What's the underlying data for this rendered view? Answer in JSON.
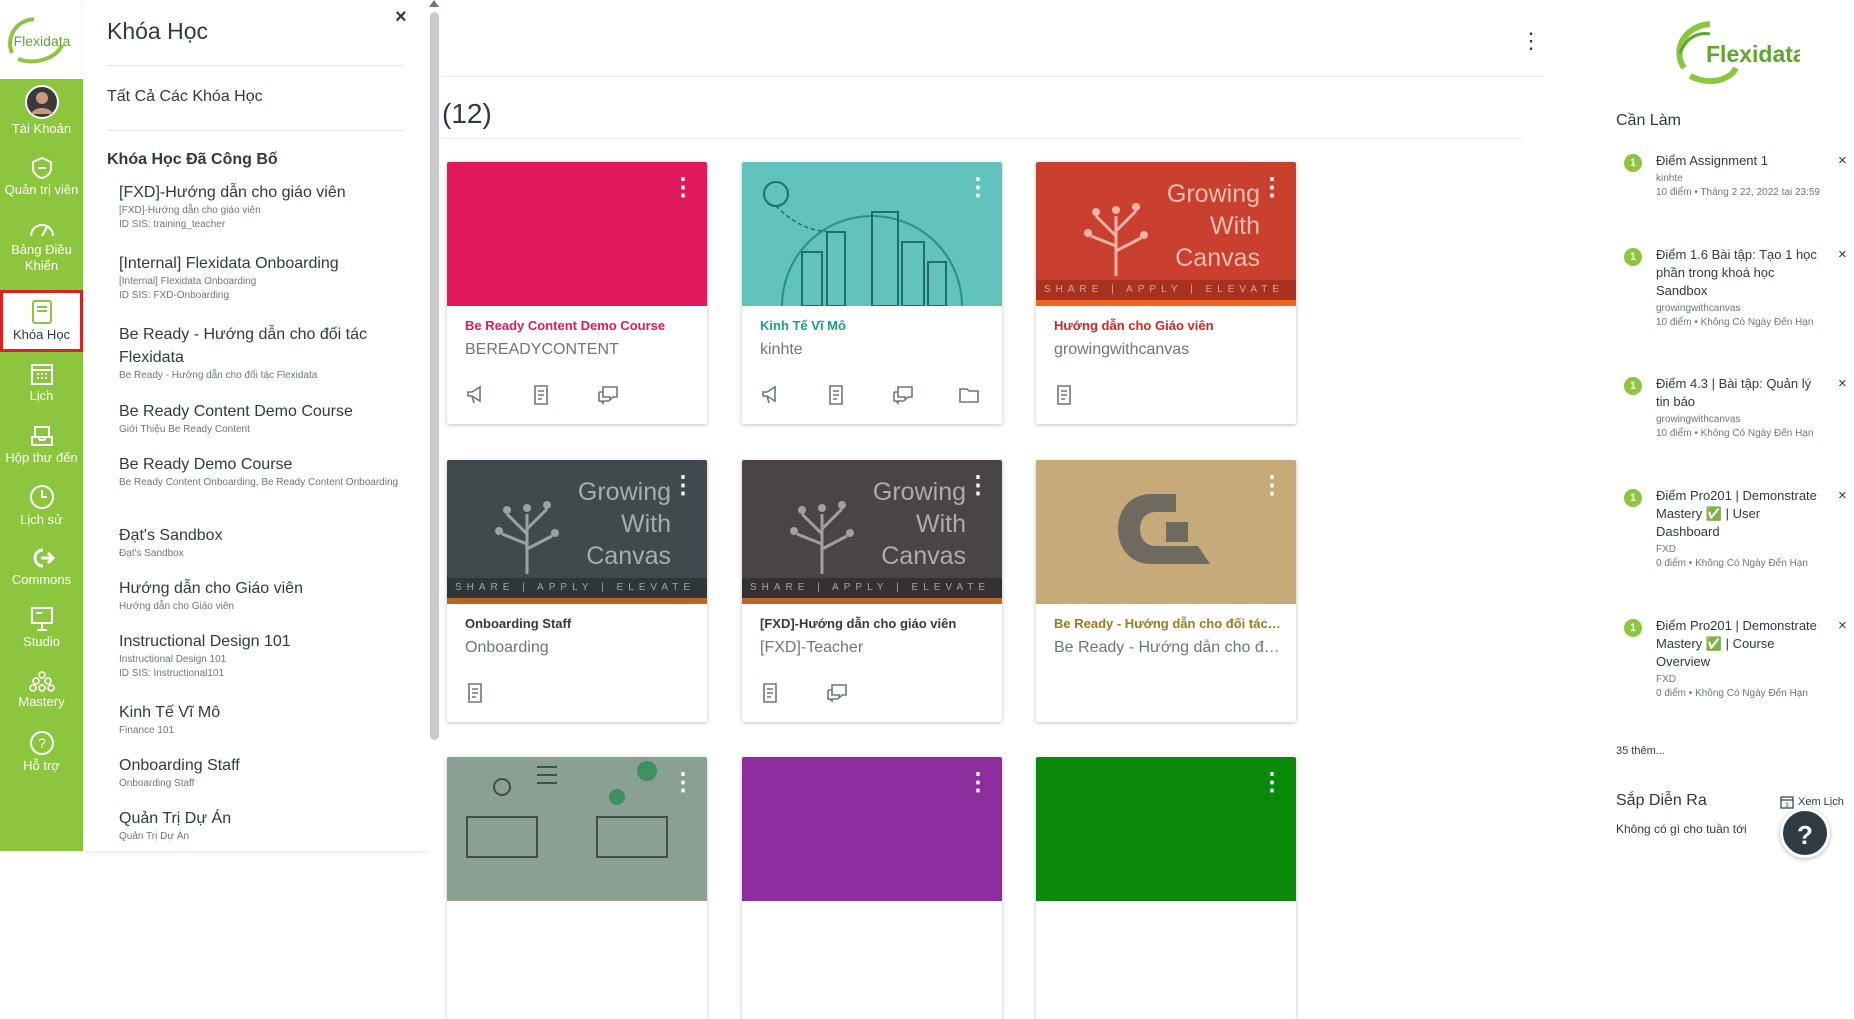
{
  "nav": {
    "logo_text": "Flexidata",
    "items": [
      {
        "label": "Tài Khoản"
      },
      {
        "label": "Quản trị viên"
      },
      {
        "label": "Bảng Điều Khiển"
      },
      {
        "label": "Khóa Học"
      },
      {
        "label": "Lịch"
      },
      {
        "label": "Hộp thư đến"
      },
      {
        "label": "Lịch sử"
      },
      {
        "label": "Commons"
      },
      {
        "label": "Studio"
      },
      {
        "label": "Mastery"
      },
      {
        "label": "Hỗ trợ"
      }
    ]
  },
  "tray": {
    "title": "Khóa Học",
    "close": "×",
    "all_courses": "Tất Cả Các Khóa Học",
    "section_title": "Khóa Học Đã Công Bố",
    "courses": [
      {
        "name": "[FXD]-Hướng dẫn cho giáo viên",
        "sub1": "[FXD]-Hướng dẫn cho giáo viên",
        "sub2": "ID SIS: training_teacher"
      },
      {
        "name": "[Internal] Flexidata Onboarding",
        "sub1": "[Internal] Flexidata Onboarding",
        "sub2": "ID SIS: FXD-Onboarding"
      },
      {
        "name": "Be Ready - Hướng dẫn cho đối tác Flexidata",
        "sub1": "Be Ready - Hướng dẫn cho đối tác Flexidata",
        "sub2": ""
      },
      {
        "name": "Be Ready Content Demo Course",
        "sub1": "Giới Thiệu Be Ready Content",
        "sub2": ""
      },
      {
        "name": "Be Ready Demo Course",
        "sub1": "Be Ready Content Onboarding, Be Ready Content Onboarding",
        "sub2": ""
      },
      {
        "name": "Đạt's Sandbox",
        "sub1": "Đạt's Sandbox",
        "sub2": ""
      },
      {
        "name": "Hướng dẫn cho Giáo viên",
        "sub1": "Hướng dẫn cho Giáo viên",
        "sub2": ""
      },
      {
        "name": "Instructional Design 101",
        "sub1": "Instructional Design 101",
        "sub2": "ID SIS: Instructional101"
      },
      {
        "name": "Kinh Tế Vĩ Mô",
        "sub1": "Finance 101",
        "sub2": ""
      },
      {
        "name": "Onboarding Staff",
        "sub1": "Onboarding Staff",
        "sub2": ""
      },
      {
        "name": "Quản Trị Dự Án",
        "sub1": "Quản Trị Dự Án",
        "sub2": ""
      }
    ]
  },
  "main": {
    "title": "(12)",
    "cards": [
      {
        "title": "Be Ready Content Demo Course",
        "code": "BEREADYCONTENT",
        "color": "#e0195c",
        "icons": [
          "announcement-icon",
          "assignment-icon",
          "discussion-icon"
        ]
      },
      {
        "title": "Kinh Tế Vĩ Mô",
        "code": "kinhte",
        "color": "#1b9e8f",
        "icons": [
          "announcement-icon",
          "assignment-icon",
          "discussion-icon",
          "folder-icon"
        ]
      },
      {
        "title": "Hướng dẫn cho Giáo viên",
        "code": "growingwithcanvas",
        "color": "#d4251f",
        "icons": [
          "assignment-icon"
        ]
      },
      {
        "title": "Onboarding Staff",
        "code": "Onboarding",
        "color": "#2d3b45",
        "icons": [
          "assignment-icon"
        ]
      },
      {
        "title": "[FXD]-Hướng dẫn cho giáo viên",
        "code": "[FXD]-Teacher",
        "color": "#2d3b45",
        "icons": [
          "assignment-icon",
          "discussion-icon"
        ]
      },
      {
        "title": "Be Ready - Hướng dẫn cho đối tác ...",
        "code": "Be Ready - Hướng dẫn cho đố...",
        "color": "#9c7a1e",
        "icons": []
      },
      {
        "title": "",
        "code": "",
        "color": "#8aa092",
        "icons": []
      },
      {
        "title": "",
        "code": "",
        "color": "#8e2d9e",
        "icons": []
      },
      {
        "title": "",
        "code": "",
        "color": "#0b8a0b",
        "icons": []
      }
    ],
    "growing": [
      "Growing",
      "With",
      "Canvas"
    ],
    "share": "SHARE | APPLY | ELEVATE"
  },
  "sidebar": {
    "logo_text": "Flexidata",
    "todo_title": "Cần Làm",
    "todos": [
      {
        "name": "Điểm Assignment 1",
        "course": "kinhte",
        "meta": "10 điểm • Tháng 2 22, 2022 tại 23:59"
      },
      {
        "name": "Điểm 1.6 Bài tập: Tạo 1 học phần trong khoá học Sandbox",
        "course": "growingwithcanvas",
        "meta": "10 điểm • Không Có Ngày Đến Hạn"
      },
      {
        "name": "Điểm 4.3 | Bài tập: Quản lý tin báo",
        "course": "growingwithcanvas",
        "meta": "10 điểm • Không Có Ngày Đến Hạn"
      },
      {
        "name": "Điểm Pro201 | Demonstrate Mastery ✅ | User Dashboard",
        "course": "FXD",
        "meta": "0 điểm • Không Có Ngày Đến Hạn"
      },
      {
        "name": "Điểm Pro201 | Demonstrate Mastery ✅ | Course Overview",
        "course": "FXD",
        "meta": "0 điểm • Không Có Ngày Đến Hạn"
      }
    ],
    "badge": "1",
    "more": "35 thêm...",
    "upcoming_title": "Sắp Diễn Ra",
    "calendar_link": "Xem Lịch",
    "calendar_day": "3",
    "nothing": "Không có gì cho tuần tới",
    "help": "?"
  }
}
